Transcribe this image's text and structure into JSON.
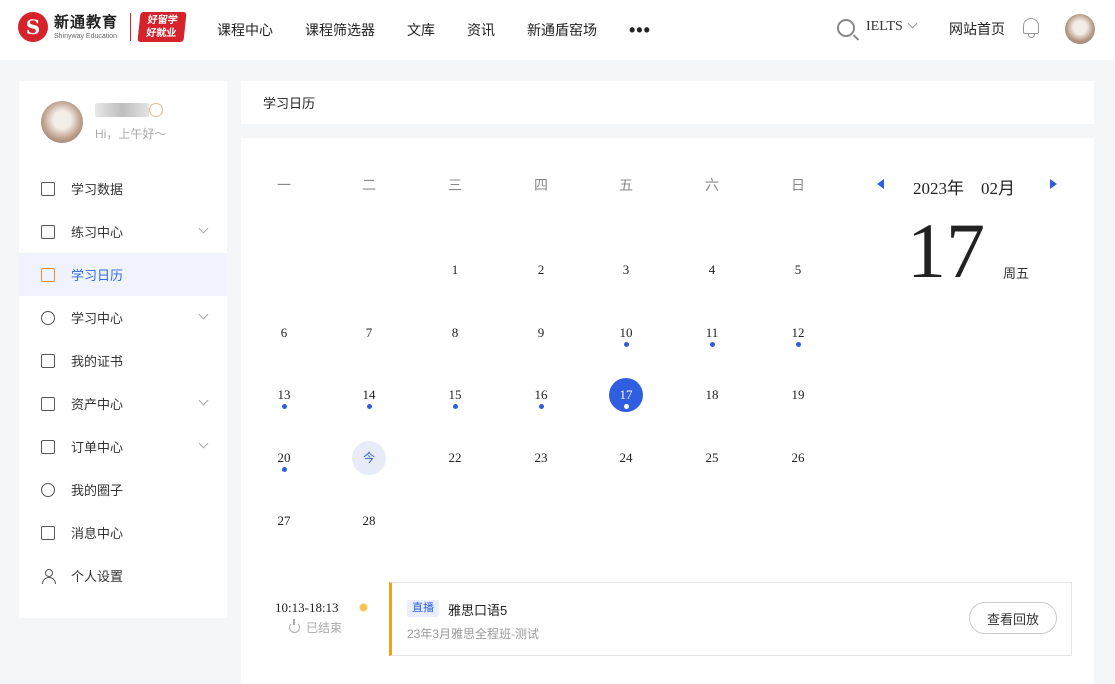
{
  "header": {
    "logo_mark": "S",
    "logo_cn": "新通教育",
    "logo_en": "Shinyway Education",
    "logo_badge_line1": "好留学",
    "logo_badge_line2": "好就业",
    "nav": [
      "课程中心",
      "课程筛选器",
      "文库",
      "资讯",
      "新通盾窑场"
    ],
    "nav_more": "•••",
    "exam": "IELTS",
    "home": "网站首页"
  },
  "user": {
    "greeting": "Hi，上午好～"
  },
  "menu": [
    {
      "label": "学习数据",
      "icon": "chart-icon"
    },
    {
      "label": "练习中心",
      "icon": "practice-icon",
      "expandable": true
    },
    {
      "label": "学习日历",
      "icon": "calendar-icon",
      "active": true
    },
    {
      "label": "学习中心",
      "icon": "graduation-cap-icon",
      "expandable": true
    },
    {
      "label": "我的证书",
      "icon": "certificate-icon"
    },
    {
      "label": "资产中心",
      "icon": "wallet-icon",
      "expandable": true
    },
    {
      "label": "订单中心",
      "icon": "clipboard-icon",
      "expandable": true
    },
    {
      "label": "我的圈子",
      "icon": "circle-icon"
    },
    {
      "label": "消息中心",
      "icon": "message-icon"
    },
    {
      "label": "个人设置",
      "icon": "person-icon"
    }
  ],
  "page_title": "学习日历",
  "calendar": {
    "weekdays": [
      "一",
      "二",
      "三",
      "四",
      "五",
      "六",
      "日"
    ],
    "month_label": "2023年　02月",
    "selected_day": "17",
    "selected_weekday": "周五",
    "today_label": "今",
    "rows": [
      [
        null,
        null,
        {
          "d": "1"
        },
        {
          "d": "2"
        },
        {
          "d": "3"
        },
        {
          "d": "4"
        },
        {
          "d": "5"
        }
      ],
      [
        {
          "d": "6"
        },
        {
          "d": "7"
        },
        {
          "d": "8"
        },
        {
          "d": "9"
        },
        {
          "d": "10",
          "dot": true
        },
        {
          "d": "11",
          "dot": true
        },
        {
          "d": "12",
          "dot": true
        }
      ],
      [
        {
          "d": "13",
          "dot": true
        },
        {
          "d": "14",
          "dot": true
        },
        {
          "d": "15",
          "dot": true
        },
        {
          "d": "16",
          "dot": true
        },
        {
          "d": "17",
          "dot": true,
          "selected": true
        },
        {
          "d": "18"
        },
        {
          "d": "19"
        }
      ],
      [
        {
          "d": "20",
          "dot": true
        },
        {
          "d": "今",
          "today": true
        },
        {
          "d": "22"
        },
        {
          "d": "23"
        },
        {
          "d": "24"
        },
        {
          "d": "25"
        },
        {
          "d": "26"
        }
      ],
      [
        {
          "d": "27"
        },
        {
          "d": "28"
        },
        null,
        null,
        null,
        null,
        null
      ]
    ]
  },
  "event": {
    "time": "10:13-18:13",
    "status": "已结束",
    "tag": "直播",
    "title": "雅思口语5",
    "subtitle": "23年3月雅思全程班-测试",
    "button": "查看回放"
  },
  "colors": {
    "accent": "#2f5fe0",
    "brand": "#d6222b",
    "event_bar": "#f0a21e"
  }
}
